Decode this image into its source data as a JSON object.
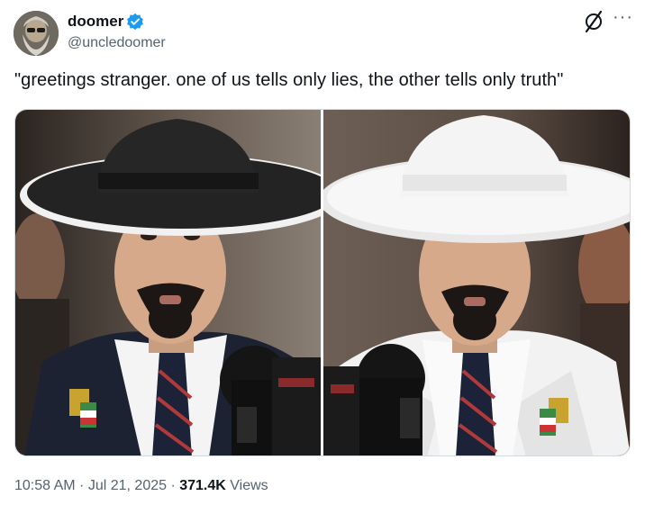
{
  "author": {
    "display_name": "doomer",
    "handle": "@uncledoomer",
    "verified_badge_icon": "verified-badge-icon",
    "badge_color": "#1d9bf0"
  },
  "header_icons": {
    "grok": "grok-icon",
    "more": "···"
  },
  "tweet": {
    "text": "\"greetings stranger. one of us tells only lies, the other tells only truth\""
  },
  "media": {
    "left_image": "man in black wide-brim hat and dark suit speaking into microphones",
    "right_image": "man in white wide-brim hat and white suit speaking into microphones"
  },
  "meta": {
    "time": "10:58 AM",
    "sep1": " · ",
    "date": "Jul 21, 2025",
    "sep2": " · ",
    "views_count": "371.4K",
    "views_label": " Views"
  }
}
